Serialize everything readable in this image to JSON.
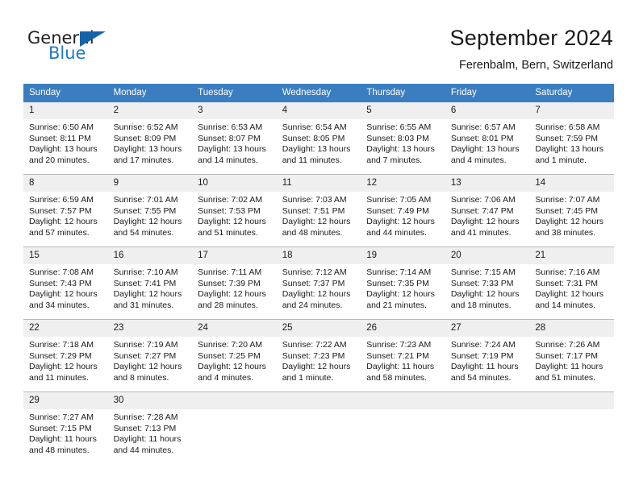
{
  "brand": {
    "name_part1": "General",
    "name_part2": "Blue",
    "triangle_icon": "triangle-icon",
    "accent_color": "#1763a8"
  },
  "header": {
    "title": "September 2024",
    "subtitle": "Ferenbalm, Bern, Switzerland"
  },
  "theme": {
    "header_row_bg": "#3a7dc0",
    "daynum_bg": "#efefef",
    "grid_line": "#b9b9b9",
    "text": "#1a1a1a"
  },
  "columns": [
    "Sunday",
    "Monday",
    "Tuesday",
    "Wednesday",
    "Thursday",
    "Friday",
    "Saturday"
  ],
  "weeks": [
    [
      {
        "day": "1",
        "sunrise": "Sunrise: 6:50 AM",
        "sunset": "Sunset: 8:11 PM",
        "daylight_line1": "Daylight: 13 hours",
        "daylight_line2": "and 20 minutes."
      },
      {
        "day": "2",
        "sunrise": "Sunrise: 6:52 AM",
        "sunset": "Sunset: 8:09 PM",
        "daylight_line1": "Daylight: 13 hours",
        "daylight_line2": "and 17 minutes."
      },
      {
        "day": "3",
        "sunrise": "Sunrise: 6:53 AM",
        "sunset": "Sunset: 8:07 PM",
        "daylight_line1": "Daylight: 13 hours",
        "daylight_line2": "and 14 minutes."
      },
      {
        "day": "4",
        "sunrise": "Sunrise: 6:54 AM",
        "sunset": "Sunset: 8:05 PM",
        "daylight_line1": "Daylight: 13 hours",
        "daylight_line2": "and 11 minutes."
      },
      {
        "day": "5",
        "sunrise": "Sunrise: 6:55 AM",
        "sunset": "Sunset: 8:03 PM",
        "daylight_line1": "Daylight: 13 hours",
        "daylight_line2": "and 7 minutes."
      },
      {
        "day": "6",
        "sunrise": "Sunrise: 6:57 AM",
        "sunset": "Sunset: 8:01 PM",
        "daylight_line1": "Daylight: 13 hours",
        "daylight_line2": "and 4 minutes."
      },
      {
        "day": "7",
        "sunrise": "Sunrise: 6:58 AM",
        "sunset": "Sunset: 7:59 PM",
        "daylight_line1": "Daylight: 13 hours",
        "daylight_line2": "and 1 minute."
      }
    ],
    [
      {
        "day": "8",
        "sunrise": "Sunrise: 6:59 AM",
        "sunset": "Sunset: 7:57 PM",
        "daylight_line1": "Daylight: 12 hours",
        "daylight_line2": "and 57 minutes."
      },
      {
        "day": "9",
        "sunrise": "Sunrise: 7:01 AM",
        "sunset": "Sunset: 7:55 PM",
        "daylight_line1": "Daylight: 12 hours",
        "daylight_line2": "and 54 minutes."
      },
      {
        "day": "10",
        "sunrise": "Sunrise: 7:02 AM",
        "sunset": "Sunset: 7:53 PM",
        "daylight_line1": "Daylight: 12 hours",
        "daylight_line2": "and 51 minutes."
      },
      {
        "day": "11",
        "sunrise": "Sunrise: 7:03 AM",
        "sunset": "Sunset: 7:51 PM",
        "daylight_line1": "Daylight: 12 hours",
        "daylight_line2": "and 48 minutes."
      },
      {
        "day": "12",
        "sunrise": "Sunrise: 7:05 AM",
        "sunset": "Sunset: 7:49 PM",
        "daylight_line1": "Daylight: 12 hours",
        "daylight_line2": "and 44 minutes."
      },
      {
        "day": "13",
        "sunrise": "Sunrise: 7:06 AM",
        "sunset": "Sunset: 7:47 PM",
        "daylight_line1": "Daylight: 12 hours",
        "daylight_line2": "and 41 minutes."
      },
      {
        "day": "14",
        "sunrise": "Sunrise: 7:07 AM",
        "sunset": "Sunset: 7:45 PM",
        "daylight_line1": "Daylight: 12 hours",
        "daylight_line2": "and 38 minutes."
      }
    ],
    [
      {
        "day": "15",
        "sunrise": "Sunrise: 7:08 AM",
        "sunset": "Sunset: 7:43 PM",
        "daylight_line1": "Daylight: 12 hours",
        "daylight_line2": "and 34 minutes."
      },
      {
        "day": "16",
        "sunrise": "Sunrise: 7:10 AM",
        "sunset": "Sunset: 7:41 PM",
        "daylight_line1": "Daylight: 12 hours",
        "daylight_line2": "and 31 minutes."
      },
      {
        "day": "17",
        "sunrise": "Sunrise: 7:11 AM",
        "sunset": "Sunset: 7:39 PM",
        "daylight_line1": "Daylight: 12 hours",
        "daylight_line2": "and 28 minutes."
      },
      {
        "day": "18",
        "sunrise": "Sunrise: 7:12 AM",
        "sunset": "Sunset: 7:37 PM",
        "daylight_line1": "Daylight: 12 hours",
        "daylight_line2": "and 24 minutes."
      },
      {
        "day": "19",
        "sunrise": "Sunrise: 7:14 AM",
        "sunset": "Sunset: 7:35 PM",
        "daylight_line1": "Daylight: 12 hours",
        "daylight_line2": "and 21 minutes."
      },
      {
        "day": "20",
        "sunrise": "Sunrise: 7:15 AM",
        "sunset": "Sunset: 7:33 PM",
        "daylight_line1": "Daylight: 12 hours",
        "daylight_line2": "and 18 minutes."
      },
      {
        "day": "21",
        "sunrise": "Sunrise: 7:16 AM",
        "sunset": "Sunset: 7:31 PM",
        "daylight_line1": "Daylight: 12 hours",
        "daylight_line2": "and 14 minutes."
      }
    ],
    [
      {
        "day": "22",
        "sunrise": "Sunrise: 7:18 AM",
        "sunset": "Sunset: 7:29 PM",
        "daylight_line1": "Daylight: 12 hours",
        "daylight_line2": "and 11 minutes."
      },
      {
        "day": "23",
        "sunrise": "Sunrise: 7:19 AM",
        "sunset": "Sunset: 7:27 PM",
        "daylight_line1": "Daylight: 12 hours",
        "daylight_line2": "and 8 minutes."
      },
      {
        "day": "24",
        "sunrise": "Sunrise: 7:20 AM",
        "sunset": "Sunset: 7:25 PM",
        "daylight_line1": "Daylight: 12 hours",
        "daylight_line2": "and 4 minutes."
      },
      {
        "day": "25",
        "sunrise": "Sunrise: 7:22 AM",
        "sunset": "Sunset: 7:23 PM",
        "daylight_line1": "Daylight: 12 hours",
        "daylight_line2": "and 1 minute."
      },
      {
        "day": "26",
        "sunrise": "Sunrise: 7:23 AM",
        "sunset": "Sunset: 7:21 PM",
        "daylight_line1": "Daylight: 11 hours",
        "daylight_line2": "and 58 minutes."
      },
      {
        "day": "27",
        "sunrise": "Sunrise: 7:24 AM",
        "sunset": "Sunset: 7:19 PM",
        "daylight_line1": "Daylight: 11 hours",
        "daylight_line2": "and 54 minutes."
      },
      {
        "day": "28",
        "sunrise": "Sunrise: 7:26 AM",
        "sunset": "Sunset: 7:17 PM",
        "daylight_line1": "Daylight: 11 hours",
        "daylight_line2": "and 51 minutes."
      }
    ],
    [
      {
        "day": "29",
        "sunrise": "Sunrise: 7:27 AM",
        "sunset": "Sunset: 7:15 PM",
        "daylight_line1": "Daylight: 11 hours",
        "daylight_line2": "and 48 minutes."
      },
      {
        "day": "30",
        "sunrise": "Sunrise: 7:28 AM",
        "sunset": "Sunset: 7:13 PM",
        "daylight_line1": "Daylight: 11 hours",
        "daylight_line2": "and 44 minutes."
      },
      {
        "day": "",
        "sunrise": "",
        "sunset": "",
        "daylight_line1": "",
        "daylight_line2": ""
      },
      {
        "day": "",
        "sunrise": "",
        "sunset": "",
        "daylight_line1": "",
        "daylight_line2": ""
      },
      {
        "day": "",
        "sunrise": "",
        "sunset": "",
        "daylight_line1": "",
        "daylight_line2": ""
      },
      {
        "day": "",
        "sunrise": "",
        "sunset": "",
        "daylight_line1": "",
        "daylight_line2": ""
      },
      {
        "day": "",
        "sunrise": "",
        "sunset": "",
        "daylight_line1": "",
        "daylight_line2": ""
      }
    ]
  ]
}
